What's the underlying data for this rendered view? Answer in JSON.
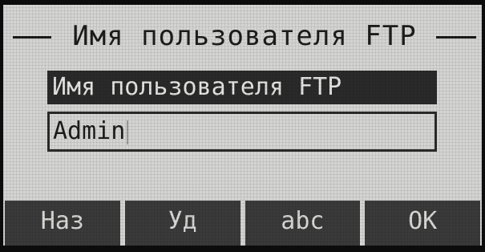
{
  "screen": {
    "title": "Имя пользователя FTP"
  },
  "field": {
    "label": "Имя пользователя FTP",
    "value": "Admin"
  },
  "softkeys": [
    {
      "label": "Наз"
    },
    {
      "label": "Уд"
    },
    {
      "label": "abc"
    },
    {
      "label": "OK"
    }
  ],
  "colors": {
    "lcd_background": "#d4d4d2",
    "lcd_foreground": "#1c1c1c",
    "highlight_background": "#2a2a2a",
    "softkey_background": "#3a3a3a"
  }
}
